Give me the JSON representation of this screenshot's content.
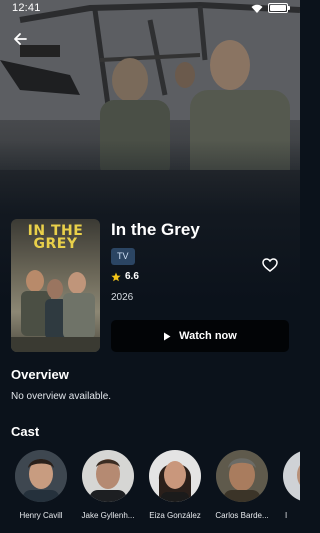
{
  "status_bar": {
    "time": "12:41"
  },
  "icons": {
    "back": "arrow-left-icon",
    "favorite": "heart-outline-icon",
    "rating": "star-icon",
    "play": "play-icon",
    "wifi": "wifi-icon",
    "battery": "battery-icon"
  },
  "show": {
    "title": "In the Grey",
    "type": "TV",
    "rating": "6.6",
    "year": "2026",
    "poster_title": "IN THE GREY"
  },
  "actions": {
    "watch_label": "Watch now"
  },
  "overview": {
    "heading": "Overview",
    "text": "No overview available."
  },
  "cast": {
    "heading": "Cast",
    "members": [
      {
        "name": "Henry Cavill"
      },
      {
        "name": "Jake Gyllenh..."
      },
      {
        "name": "Eiza González"
      },
      {
        "name": "Carlos Barde..."
      },
      {
        "name": "I"
      }
    ]
  },
  "colors": {
    "background": "#0b121b",
    "badge": "#2b4563",
    "star": "#f5c518",
    "watch_button": "#020406"
  }
}
